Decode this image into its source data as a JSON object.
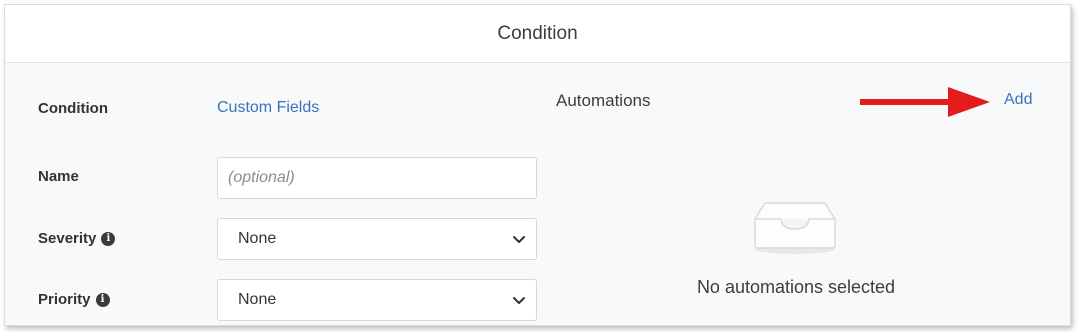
{
  "header": {
    "title": "Condition"
  },
  "form": {
    "condition": {
      "label": "Condition",
      "value": "Custom Fields"
    },
    "name": {
      "label": "Name",
      "placeholder": "(optional)",
      "value": ""
    },
    "severity": {
      "label": "Severity",
      "selected": "None"
    },
    "priority": {
      "label": "Priority",
      "selected": "None"
    }
  },
  "automations": {
    "title": "Automations",
    "add_label": "Add",
    "empty_text": "No automations selected"
  },
  "colors": {
    "link": "#3b73b9",
    "annotation_arrow": "#e31b1b"
  },
  "icons": {
    "info": "info-circle-icon",
    "select_chevron": "chevron-down-icon",
    "empty_state": "inbox-tray-icon",
    "annotation": "red-arrow-icon"
  }
}
